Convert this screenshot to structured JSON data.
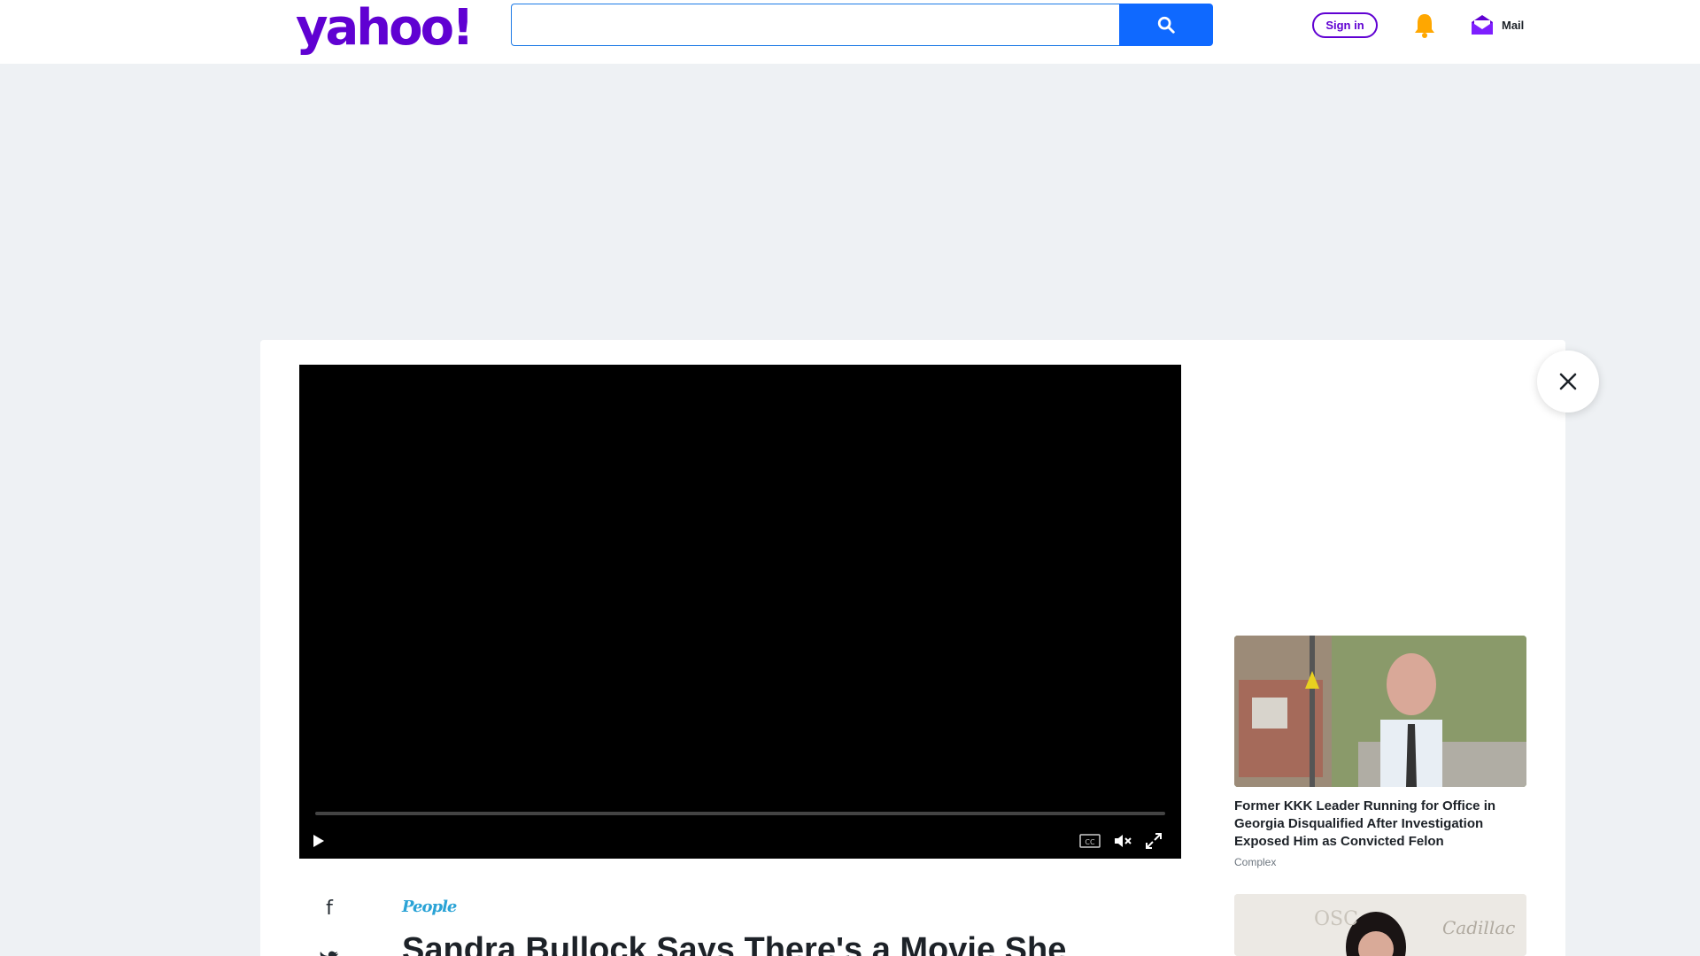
{
  "header": {
    "logo_text": "yahoo!",
    "search_placeholder": "",
    "search_value": "",
    "signin_label": "Sign in",
    "mail_label": "Mail",
    "brand_color": "#6001d2",
    "search_button_color": "#0f69ff"
  },
  "video_player": {
    "progress": 0,
    "controls": [
      "play-icon",
      "closed-captions-icon",
      "mute-icon",
      "fullscreen-icon"
    ]
  },
  "article": {
    "provider": "People",
    "headline": "Sandra Bullock Says There's a Movie She"
  },
  "sidebar": {
    "cards": [
      {
        "title": "Former KKK Leader Running for Office in Georgia Disqualified After Investigation Exposed Him as Convicted Felon",
        "source": "Complex"
      },
      {
        "title": "",
        "source": ""
      }
    ]
  }
}
